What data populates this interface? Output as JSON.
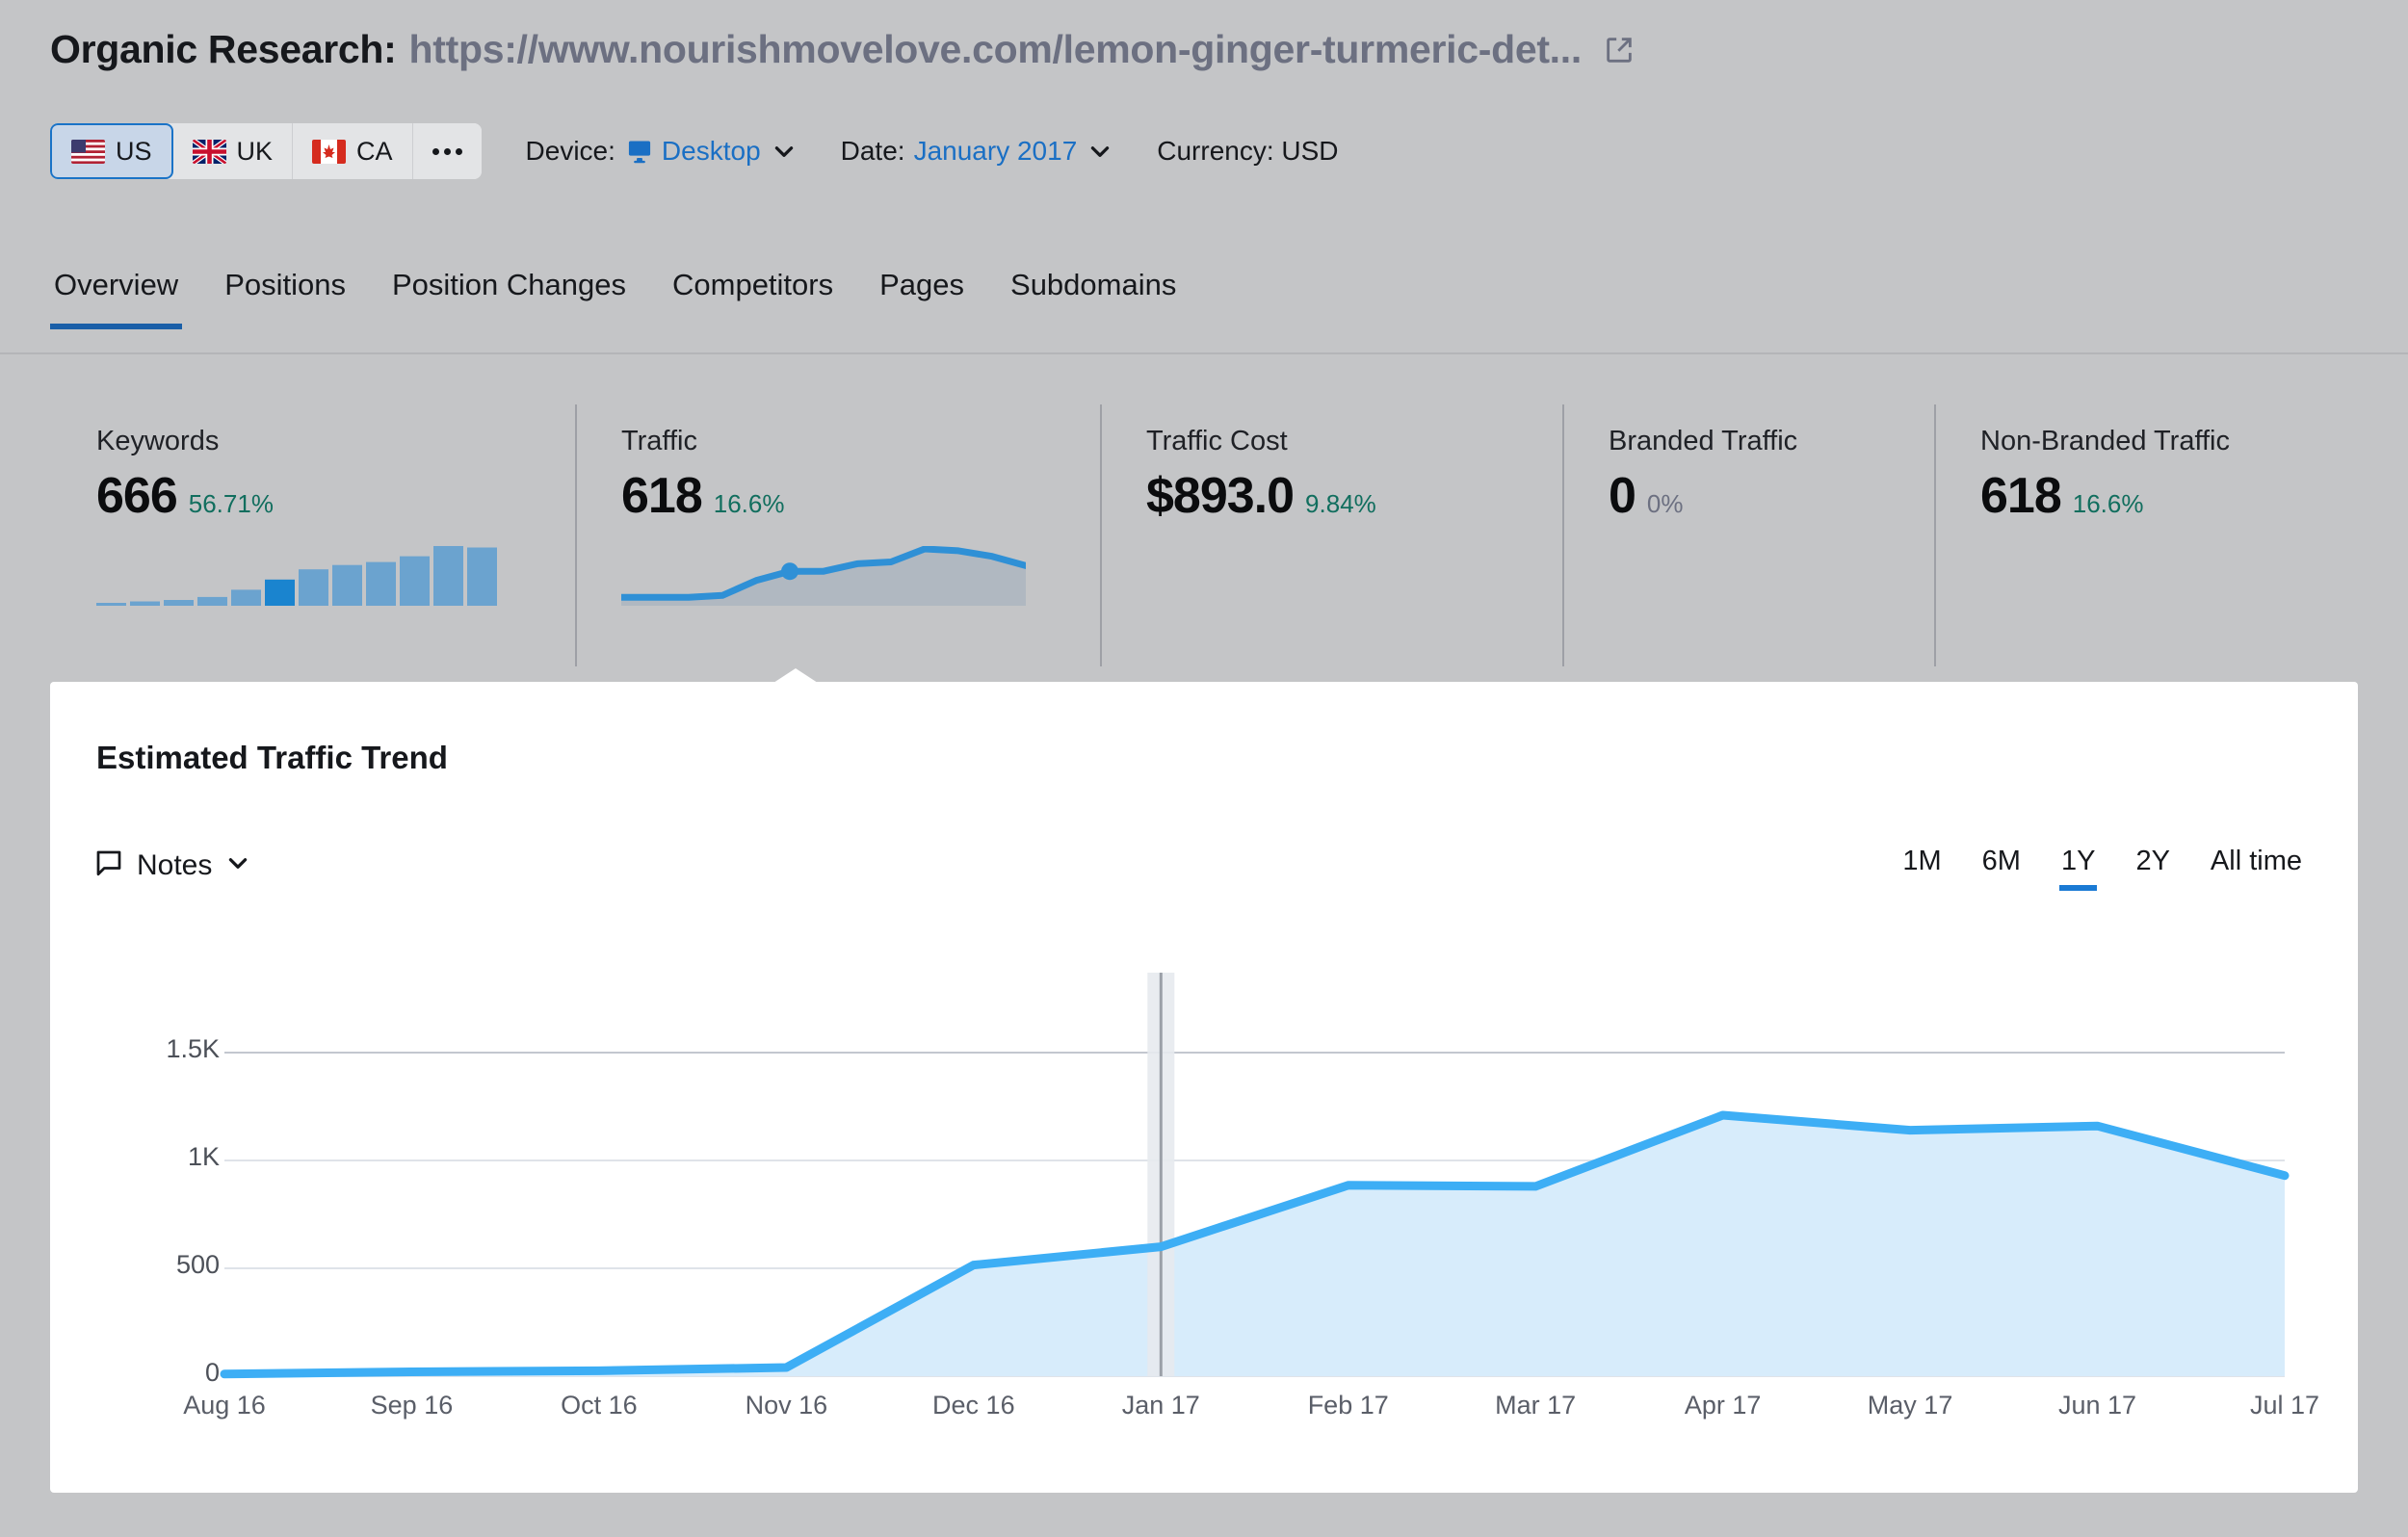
{
  "header": {
    "title_static": "Organic Research:",
    "title_url": "https://www.nourishmovelove.com/lemon-ginger-turmeric-det...",
    "external_link_icon": "external-link-icon"
  },
  "countries": [
    {
      "code": "US",
      "label": "US",
      "flag": "us-flag-icon",
      "active": true
    },
    {
      "code": "UK",
      "label": "UK",
      "flag": "uk-flag-icon",
      "active": false
    },
    {
      "code": "CA",
      "label": "CA",
      "flag": "ca-flag-icon",
      "active": false
    }
  ],
  "more_countries_label": "more-countries-button",
  "controls": {
    "device_label": "Device:",
    "device_value": "Desktop",
    "device_icon": "monitor-icon",
    "date_label": "Date:",
    "date_value": "January 2017",
    "currency_label": "Currency: USD"
  },
  "nav_tabs": [
    {
      "label": "Overview",
      "active": true
    },
    {
      "label": "Positions",
      "active": false
    },
    {
      "label": "Position Changes",
      "active": false
    },
    {
      "label": "Competitors",
      "active": false
    },
    {
      "label": "Pages",
      "active": false
    },
    {
      "label": "Subdomains",
      "active": false
    }
  ],
  "metrics": [
    {
      "label": "Keywords",
      "value": "666",
      "delta": "56.71%",
      "delta_tone": "green"
    },
    {
      "label": "Traffic",
      "value": "618",
      "delta": "16.6%",
      "delta_tone": "green"
    },
    {
      "label": "Traffic Cost",
      "value": "$893.0",
      "delta": "9.84%",
      "delta_tone": "green"
    },
    {
      "label": "Branded Traffic",
      "value": "0",
      "delta": "0%",
      "delta_tone": "grey"
    },
    {
      "label": "Non-Branded Traffic",
      "value": "618",
      "delta": "16.6%",
      "delta_tone": "green"
    }
  ],
  "sparklines": {
    "keywords_bars": [
      2,
      3,
      4,
      6,
      11,
      18,
      25,
      28,
      30,
      34,
      41,
      40
    ],
    "keywords_highlight_index": 5,
    "traffic_points": [
      3,
      3,
      3,
      4,
      12,
      17,
      17,
      21,
      22,
      29,
      28,
      25,
      20
    ]
  },
  "panel": {
    "title": "Estimated Traffic Trend",
    "notes_label": "Notes",
    "notes_icon": "note-bubble-icon",
    "notes_caret_icon": "chevron-down-icon"
  },
  "ranges": [
    {
      "label": "1M",
      "active": false
    },
    {
      "label": "6M",
      "active": false
    },
    {
      "label": "1Y",
      "active": true
    },
    {
      "label": "2Y",
      "active": false
    },
    {
      "label": "All time",
      "active": false
    }
  ],
  "colors": {
    "accent_blue": "#3daef5",
    "area_fill": "#d7ecfb",
    "link_blue": "#1a6fc4",
    "tab_underline": "#1a5fa8",
    "delta_green": "#116e5e",
    "page_bg": "#c4c5c7",
    "panel_bg": "#ffffff"
  },
  "chart_data": {
    "type": "area",
    "title": "Estimated Traffic Trend",
    "xlabel": "",
    "ylabel": "",
    "x": [
      "Aug 16",
      "Sep 16",
      "Oct 16",
      "Nov 16",
      "Dec 16",
      "Jan 17",
      "Feb 17",
      "Mar 17",
      "Apr 17",
      "May 17",
      "Jun 17",
      "Jul 17"
    ],
    "categories": [
      "Aug 16",
      "Sep 16",
      "Oct 16",
      "Nov 16",
      "Dec 16",
      "Jan 17",
      "Feb 17",
      "Mar 17",
      "Apr 17",
      "May 17",
      "Jun 17",
      "Jul 17"
    ],
    "values": [
      10,
      20,
      25,
      40,
      515,
      600,
      885,
      880,
      1210,
      1140,
      1160,
      930
    ],
    "series": [
      {
        "name": "Estimated Traffic",
        "values": [
          10,
          20,
          25,
          40,
          515,
          600,
          885,
          880,
          1210,
          1140,
          1160,
          930
        ]
      }
    ],
    "ytick_labels": [
      "1.5K",
      "1K",
      "500",
      "0"
    ],
    "ytick_values": [
      1500,
      1000,
      500,
      0
    ],
    "ylim": [
      0,
      1500
    ],
    "grid": true,
    "legend": "none",
    "cursor_marker": {
      "at": "Jan 17",
      "value": 600
    }
  }
}
